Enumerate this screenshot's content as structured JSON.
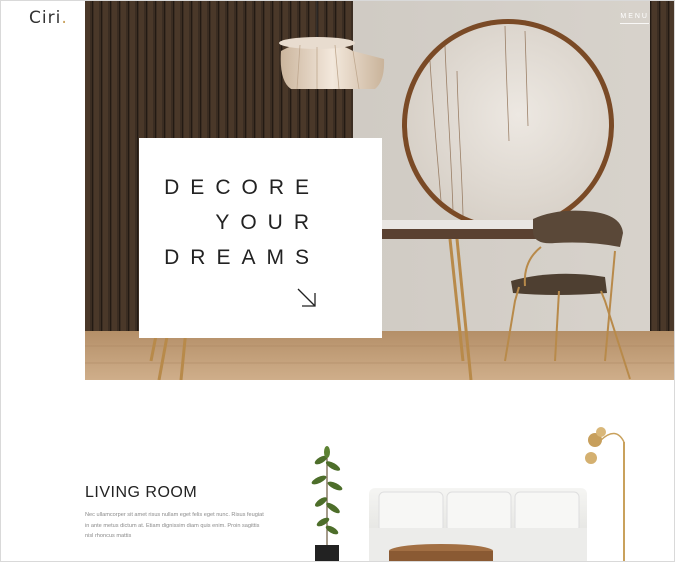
{
  "brand": {
    "logo_text": "Ciri",
    "logo_dot": "."
  },
  "nav": {
    "menu_label": "MENU"
  },
  "hero": {
    "title_lines": [
      "DECORE",
      "YOUR",
      "DREAMS"
    ],
    "arrow_icon": "arrow-down-right-icon"
  },
  "living_room": {
    "title": "LIVING ROOM",
    "text": "Nec ullamcorper sit amet risus nullam eget felis eget nunc. Risus feugiat in ante metus dictum at. Etiam dignissim diam quis enim. Proin sagittis nisl rhoncus mattis"
  },
  "colors": {
    "accent": "#c9a15c",
    "text": "#222222",
    "muted": "#8a8a8a"
  }
}
